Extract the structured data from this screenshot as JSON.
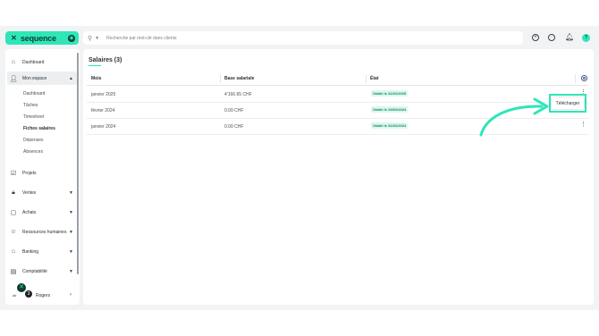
{
  "colors": {
    "accent": "#2ee6b8",
    "status_bg": "#dcf7ee",
    "status_text": "#17895f"
  },
  "header": {
    "logo_text": "sequence",
    "search_placeholder": "Recherche par mot-clé dans clients",
    "icons": [
      "plus-circle-icon",
      "clock-icon",
      "bell-icon",
      "avatar"
    ]
  },
  "sidebar": {
    "items": [
      {
        "label": "Dashboard",
        "icon": "home-icon"
      },
      {
        "label": "Mon espace",
        "icon": "user-icon"
      },
      {
        "label": "Projets",
        "icon": "checkbox-icon"
      },
      {
        "label": "Ventes",
        "icon": "bag-icon"
      },
      {
        "label": "Achats",
        "icon": "shopping-bag-icon"
      },
      {
        "label": "Ressources humaines",
        "icon": "people-icon"
      },
      {
        "label": "Banking",
        "icon": "bank-icon"
      },
      {
        "label": "Comptabilité",
        "icon": "ledger-icon"
      }
    ],
    "sub_items": [
      "Dashboard",
      "Tâches",
      "Timesheet",
      "Fiches salaires",
      "Dépenses",
      "Absences"
    ],
    "current_sub": "Fiches salaires",
    "footer_user": "Rogers",
    "footer_small": "ok",
    "notification_count": "3"
  },
  "main": {
    "title": "Salaires (3)",
    "columns": [
      "Mois",
      "Base salariale",
      "État"
    ],
    "rows": [
      {
        "month": "janvier 2025",
        "base": "4'166.65 CHF",
        "state": "Validé le 31/01/2025"
      },
      {
        "month": "février 2024",
        "base": "0.00 CHF",
        "state": "Validé le 29/02/2024"
      },
      {
        "month": "janvier 2024",
        "base": "0.00 CHF",
        "state": "Validé le 31/01/2024"
      }
    ],
    "download_label": "Télécharger"
  }
}
